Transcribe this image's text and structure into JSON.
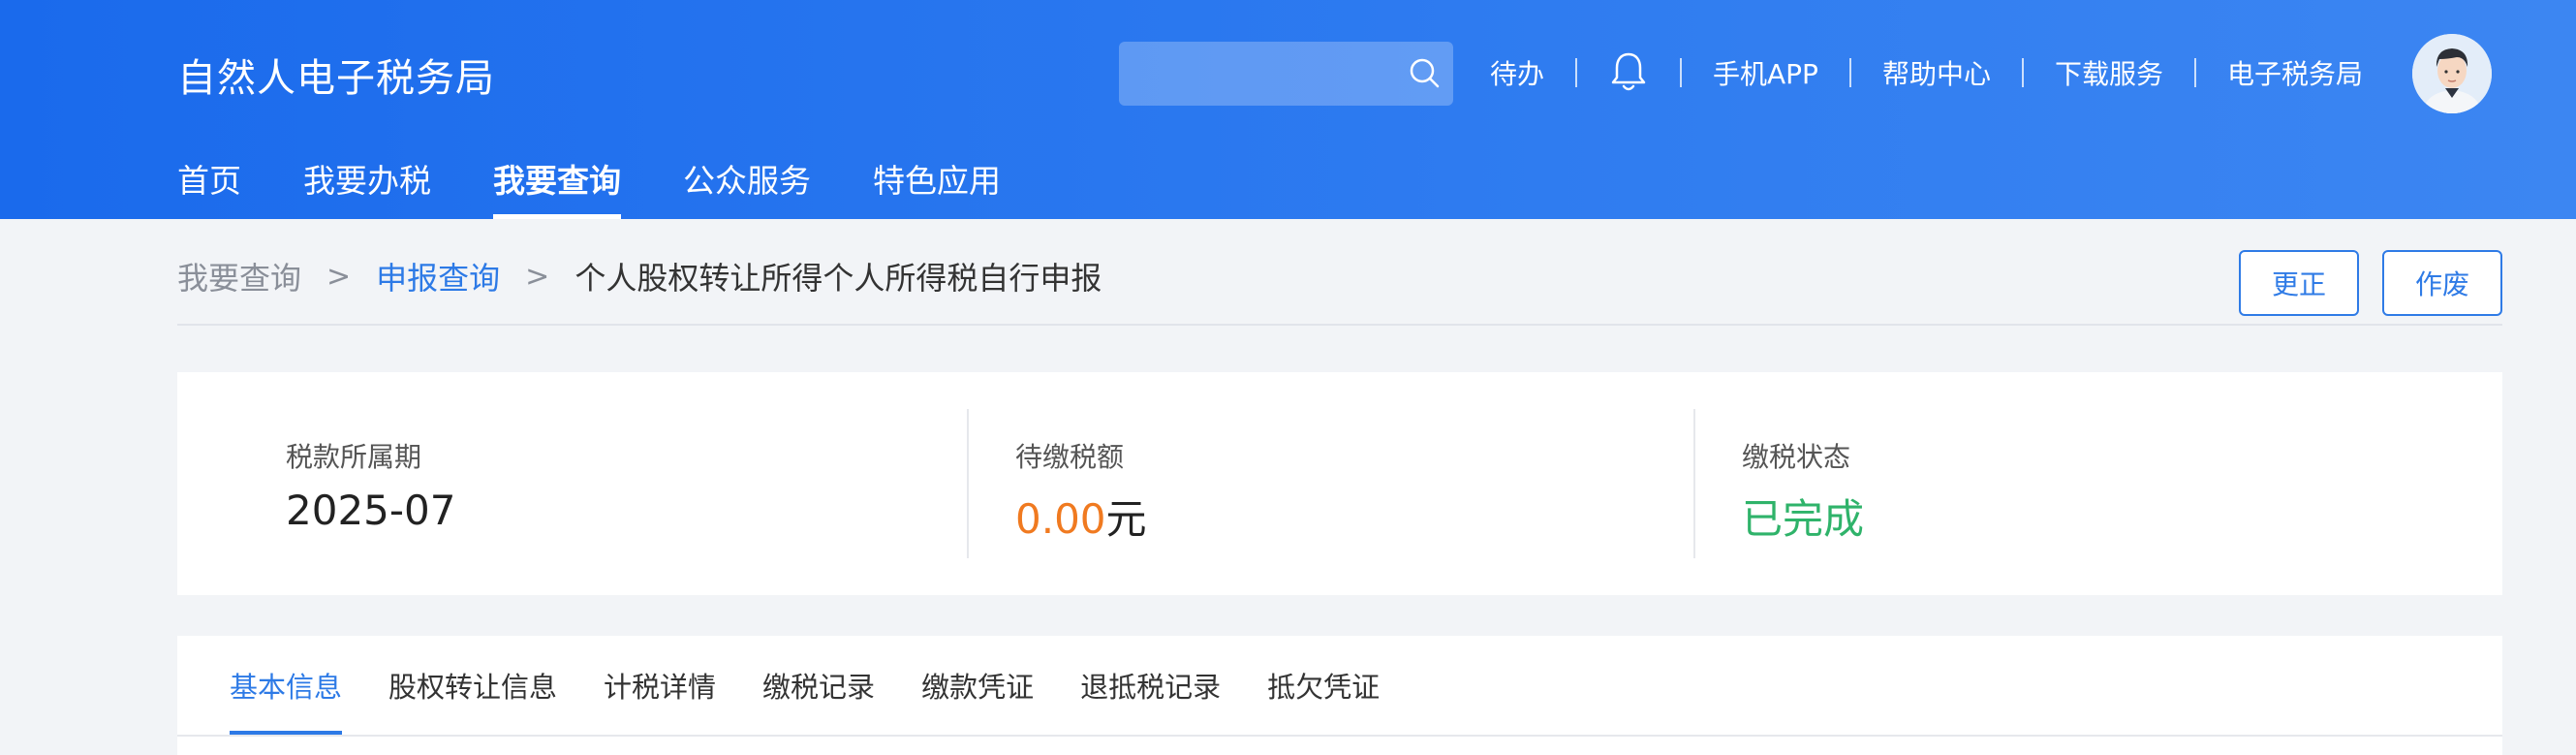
{
  "header": {
    "brand": "自然人电子税务局",
    "search": {
      "placeholder": ""
    },
    "links": [
      "待办",
      "手机APP",
      "帮助中心",
      "下载服务",
      "电子税务局"
    ],
    "nav": [
      "首页",
      "我要办税",
      "我要查询",
      "公众服务",
      "特色应用"
    ],
    "active_nav": "我要查询"
  },
  "breadcrumb": {
    "items": [
      "我要查询",
      "申报查询",
      "个人股权转让所得个人所得税自行申报"
    ],
    "separator": ">"
  },
  "actions": {
    "correct": "更正",
    "void": "作废"
  },
  "summary": {
    "period_label": "税款所属期",
    "period_value": "2025-07",
    "due_label": "待缴税额",
    "due_amount": "0.00",
    "due_unit": "元",
    "status_label": "缴税状态",
    "status_value": "已完成"
  },
  "tabs": [
    "基本信息",
    "股权转让信息",
    "计税详情",
    "缴税记录",
    "缴款凭证",
    "退抵税记录",
    "抵欠凭证"
  ],
  "active_tab": "基本信息",
  "colors": {
    "header_blue": "#1a6aec",
    "link_blue": "#2d7ae6",
    "amount_orange": "#f07a20",
    "status_green": "#2fb36a"
  }
}
